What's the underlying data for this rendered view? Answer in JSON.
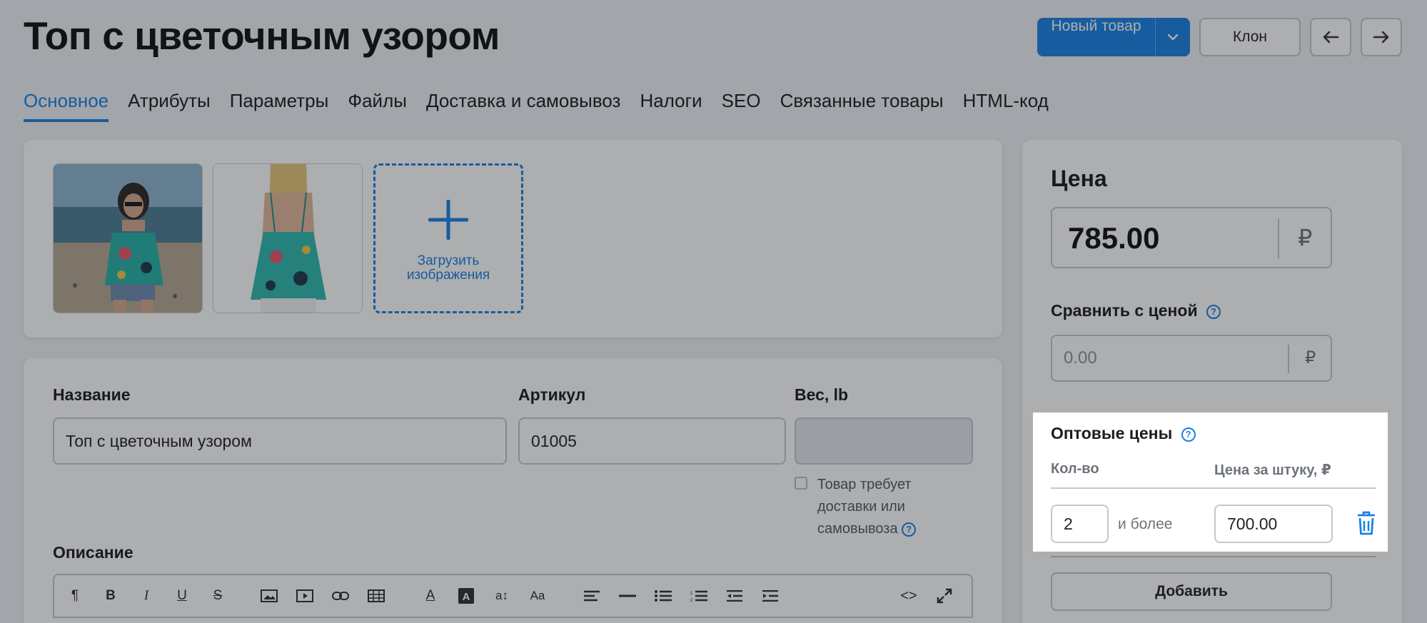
{
  "header": {
    "title": "Топ с цветочным узором",
    "new_item_label": "Новый товар",
    "clone_label": "Клон"
  },
  "tabs": [
    {
      "label": "Основное"
    },
    {
      "label": "Атрибуты"
    },
    {
      "label": "Параметры"
    },
    {
      "label": "Файлы"
    },
    {
      "label": "Доставка и самовывоз"
    },
    {
      "label": "Налоги"
    },
    {
      "label": "SEO"
    },
    {
      "label": "Связанные товары"
    },
    {
      "label": "HTML-код"
    }
  ],
  "images": {
    "upload_label": "Загрузить изображения"
  },
  "form": {
    "name_label": "Название",
    "name_value": "Топ с цветочным узором",
    "sku_label": "Артикул",
    "sku_value": "01005",
    "weight_label": "Вес, lb",
    "weight_value": "",
    "shipping_checkbox_label": "Товар требует доставки или самовывоза",
    "description_label": "Описание"
  },
  "price": {
    "title": "Цена",
    "value": "785.00",
    "currency": "₽",
    "compare_label": "Сравнить с ценой",
    "compare_placeholder": "0.00",
    "wholesale_title": "Оптовые цены",
    "col_qty": "Кол-во",
    "col_price": "Цена за штуку, ₽",
    "tiers": [
      {
        "qty": "2",
        "and_more": "и более",
        "price": "700.00"
      }
    ],
    "add_label": "Добавить"
  },
  "colors": {
    "accent": "#1a82e3"
  }
}
